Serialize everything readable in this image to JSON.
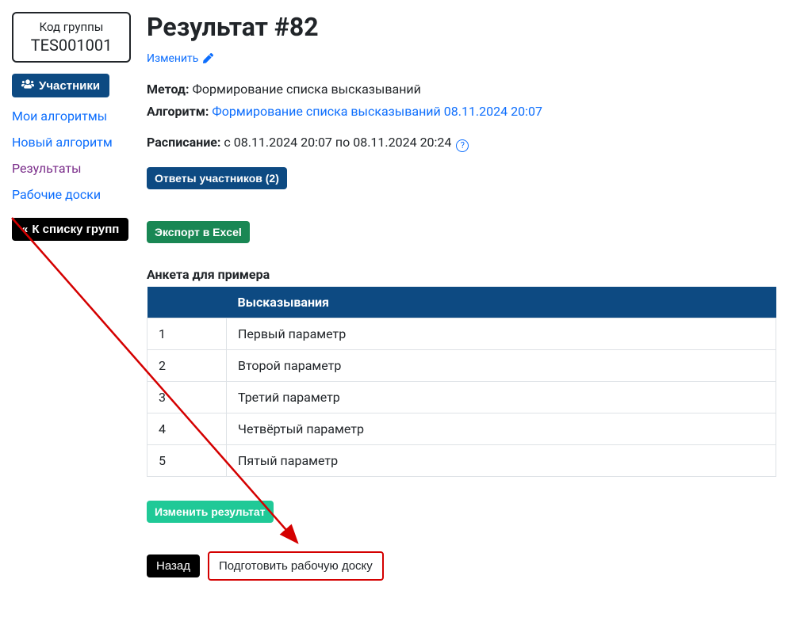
{
  "sidebar": {
    "group_code_label": "Код группы",
    "group_code_value": "TES001001",
    "participants_btn": "Участники",
    "nav": [
      {
        "label": "Мои алгоритмы",
        "active": false
      },
      {
        "label": "Новый алгоритм",
        "active": false
      },
      {
        "label": "Результаты",
        "active": true
      },
      {
        "label": "Рабочие доски",
        "active": false
      }
    ],
    "back_to_groups": "К списку групп"
  },
  "main": {
    "title": "Результат #82",
    "edit_link": "Изменить",
    "meta": {
      "method_label": "Метод:",
      "method_value": "Формирование списка высказываний",
      "algorithm_label": "Алгоритм:",
      "algorithm_link": "Формирование списка высказываний 08.11.2024 20:07",
      "schedule_label": "Расписание:",
      "schedule_value": "с 08.11.2024 20:07 по 08.11.2024 20:24"
    },
    "answers_btn": "Ответы участников (2)",
    "export_btn": "Экспорт в Excel",
    "table": {
      "title": "Анкета для примера",
      "header_num": "",
      "header_statement": "Высказывания",
      "rows": [
        {
          "num": "1",
          "text": "Первый параметр"
        },
        {
          "num": "2",
          "text": "Второй параметр"
        },
        {
          "num": "3",
          "text": "Третий параметр"
        },
        {
          "num": "4",
          "text": "Четвёртый параметр"
        },
        {
          "num": "5",
          "text": "Пятый параметр"
        }
      ]
    },
    "change_result_btn": "Изменить результат",
    "back_btn": "Назад",
    "prepare_board_btn": "Подготовить рабочую доску"
  }
}
